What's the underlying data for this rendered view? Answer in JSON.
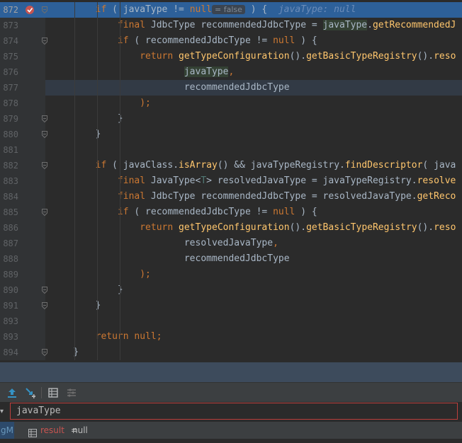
{
  "editor": {
    "inlay_hint": "= false",
    "debug_value": "javaType: null",
    "lines": [
      {
        "n": "872",
        "segs": [
          [
            "",
            "        "
          ],
          [
            "kw",
            "if"
          ],
          [
            "",
            " ( javaType != "
          ],
          [
            "kw",
            "null"
          ]
        ]
      },
      {
        "n": "873",
        "segs": [
          [
            "",
            "            "
          ],
          [
            "kw",
            "final"
          ],
          [
            "",
            " JdbcType recommendedJdbcType = "
          ],
          [
            "hl-var",
            "javaType"
          ],
          [
            "",
            "."
          ],
          [
            "m",
            "getRecommendedJ"
          ]
        ]
      },
      {
        "n": "874",
        "segs": [
          [
            "",
            "            "
          ],
          [
            "kw",
            "if"
          ],
          [
            "",
            " ( recommendedJdbcType != "
          ],
          [
            "kw",
            "null"
          ],
          [
            "",
            " ) {"
          ]
        ]
      },
      {
        "n": "875",
        "segs": [
          [
            "",
            "                "
          ],
          [
            "kw",
            "return"
          ],
          [
            "",
            " "
          ],
          [
            "m",
            "getTypeConfiguration"
          ],
          [
            "",
            "()."
          ],
          [
            "m",
            "getBasicTypeRegistry"
          ],
          [
            "",
            "()."
          ],
          [
            "m",
            "reso"
          ]
        ]
      },
      {
        "n": "876",
        "segs": [
          [
            "",
            "                        "
          ],
          [
            "hl-var",
            "javaType"
          ],
          [
            "kw",
            ","
          ]
        ]
      },
      {
        "n": "877",
        "segs": [
          [
            "",
            "                        recommendedJdbcType"
          ]
        ]
      },
      {
        "n": "878",
        "segs": [
          [
            "",
            "                "
          ],
          [
            "kw",
            ");"
          ]
        ]
      },
      {
        "n": "879",
        "segs": [
          [
            "",
            "            }"
          ]
        ]
      },
      {
        "n": "880",
        "segs": [
          [
            "",
            "        }"
          ]
        ]
      },
      {
        "n": "881",
        "segs": [
          [
            "",
            ""
          ]
        ]
      },
      {
        "n": "882",
        "segs": [
          [
            "",
            "        "
          ],
          [
            "kw",
            "if"
          ],
          [
            "",
            " ( javaClass."
          ],
          [
            "m",
            "isArray"
          ],
          [
            "",
            "() && javaTypeRegistry."
          ],
          [
            "m",
            "findDescriptor"
          ],
          [
            "",
            "( java"
          ]
        ]
      },
      {
        "n": "883",
        "segs": [
          [
            "",
            "            "
          ],
          [
            "kw",
            "final"
          ],
          [
            "",
            " JavaType<"
          ],
          [
            "tp",
            "T"
          ],
          [
            "",
            "> resolvedJavaType = javaTypeRegistry."
          ],
          [
            "m",
            "resolve"
          ]
        ]
      },
      {
        "n": "884",
        "segs": [
          [
            "",
            "            "
          ],
          [
            "kw",
            "final"
          ],
          [
            "",
            " JdbcType recommendedJdbcType = resolvedJavaType."
          ],
          [
            "m",
            "getReco"
          ]
        ]
      },
      {
        "n": "885",
        "segs": [
          [
            "",
            "            "
          ],
          [
            "kw",
            "if"
          ],
          [
            "",
            " ( recommendedJdbcType != "
          ],
          [
            "kw",
            "null"
          ],
          [
            "",
            " ) {"
          ]
        ]
      },
      {
        "n": "886",
        "segs": [
          [
            "",
            "                "
          ],
          [
            "kw",
            "return"
          ],
          [
            "",
            " "
          ],
          [
            "m",
            "getTypeConfiguration"
          ],
          [
            "",
            "()."
          ],
          [
            "m",
            "getBasicTypeRegistry"
          ],
          [
            "",
            "()."
          ],
          [
            "m",
            "reso"
          ]
        ]
      },
      {
        "n": "887",
        "segs": [
          [
            "",
            "                        resolvedJavaType"
          ],
          [
            "kw",
            ","
          ]
        ]
      },
      {
        "n": "888",
        "segs": [
          [
            "",
            "                        recommendedJdbcType"
          ]
        ]
      },
      {
        "n": "889",
        "segs": [
          [
            "",
            "                "
          ],
          [
            "kw",
            ");"
          ]
        ]
      },
      {
        "n": "890",
        "segs": [
          [
            "",
            "            }"
          ]
        ]
      },
      {
        "n": "891",
        "segs": [
          [
            "",
            "        }"
          ]
        ]
      },
      {
        "n": "893",
        "segs": [
          [
            "",
            ""
          ]
        ]
      },
      {
        "n": "893",
        "segs": [
          [
            "",
            "        "
          ],
          [
            "kw",
            "return null;"
          ]
        ]
      },
      {
        "n": "894",
        "segs": [
          [
            "",
            "    }"
          ]
        ]
      }
    ]
  },
  "evaluate": {
    "expression": "javaType",
    "left_stub": "gM"
  },
  "result": {
    "name": "result",
    "eq": " = ",
    "value": "null"
  },
  "colors": {
    "breakpoint": "#c75450",
    "execution_line": "#2d6099",
    "caret_line": "#323a45",
    "error_border": "#bc3f3c"
  }
}
